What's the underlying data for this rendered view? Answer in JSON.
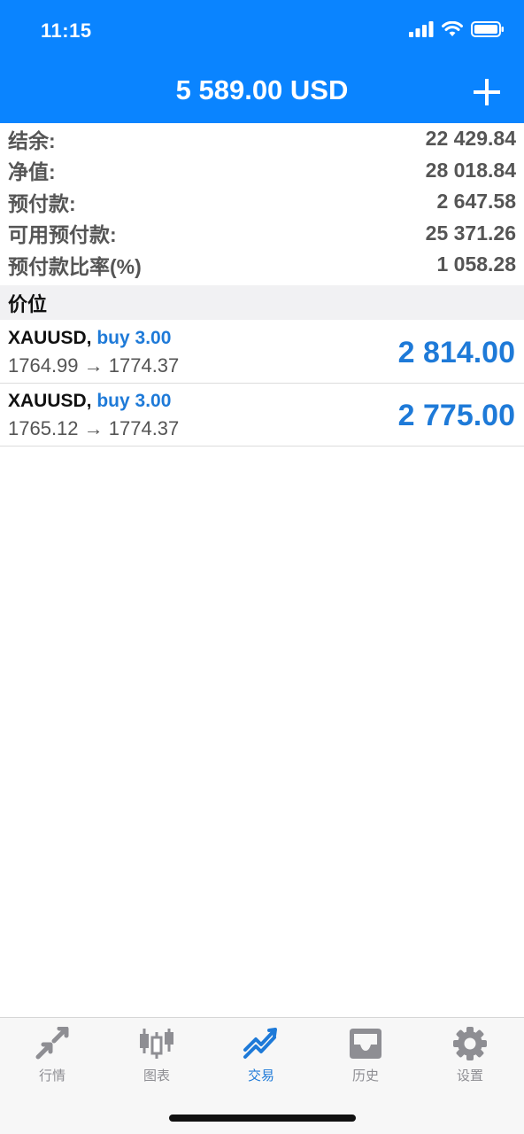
{
  "status_bar": {
    "time": "11:15"
  },
  "header": {
    "title": "5 589.00 USD",
    "add_icon": "plus-icon"
  },
  "summary": [
    {
      "label": "结余:",
      "value": "22 429.84"
    },
    {
      "label": "净值:",
      "value": "28 018.84"
    },
    {
      "label": "预付款:",
      "value": "2 647.58"
    },
    {
      "label": "可用预付款:",
      "value": "25 371.26"
    },
    {
      "label": "预付款比率(%)",
      "value": "1 058.28"
    }
  ],
  "section": {
    "title": "价位"
  },
  "positions": [
    {
      "symbol": "XAUUSD,",
      "direction": "buy 3.00",
      "prices": "1764.99 → 1774.37",
      "profit": "2 814.00"
    },
    {
      "symbol": "XAUUSD,",
      "direction": "buy 3.00",
      "prices": "1765.12 → 1774.37",
      "profit": "2 775.00"
    }
  ],
  "tabbar": {
    "tabs": [
      {
        "label": "行情",
        "icon": "quotes-arrows-icon"
      },
      {
        "label": "图表",
        "icon": "candlestick-chart-icon"
      },
      {
        "label": "交易",
        "icon": "trade-trend-icon",
        "active": true
      },
      {
        "label": "历史",
        "icon": "history-inbox-icon"
      },
      {
        "label": "设置",
        "icon": "gear-icon"
      }
    ]
  },
  "colors": {
    "header_bg": "#0a84ff",
    "accent": "#1e7ad8",
    "inactive": "#8e8e93"
  }
}
